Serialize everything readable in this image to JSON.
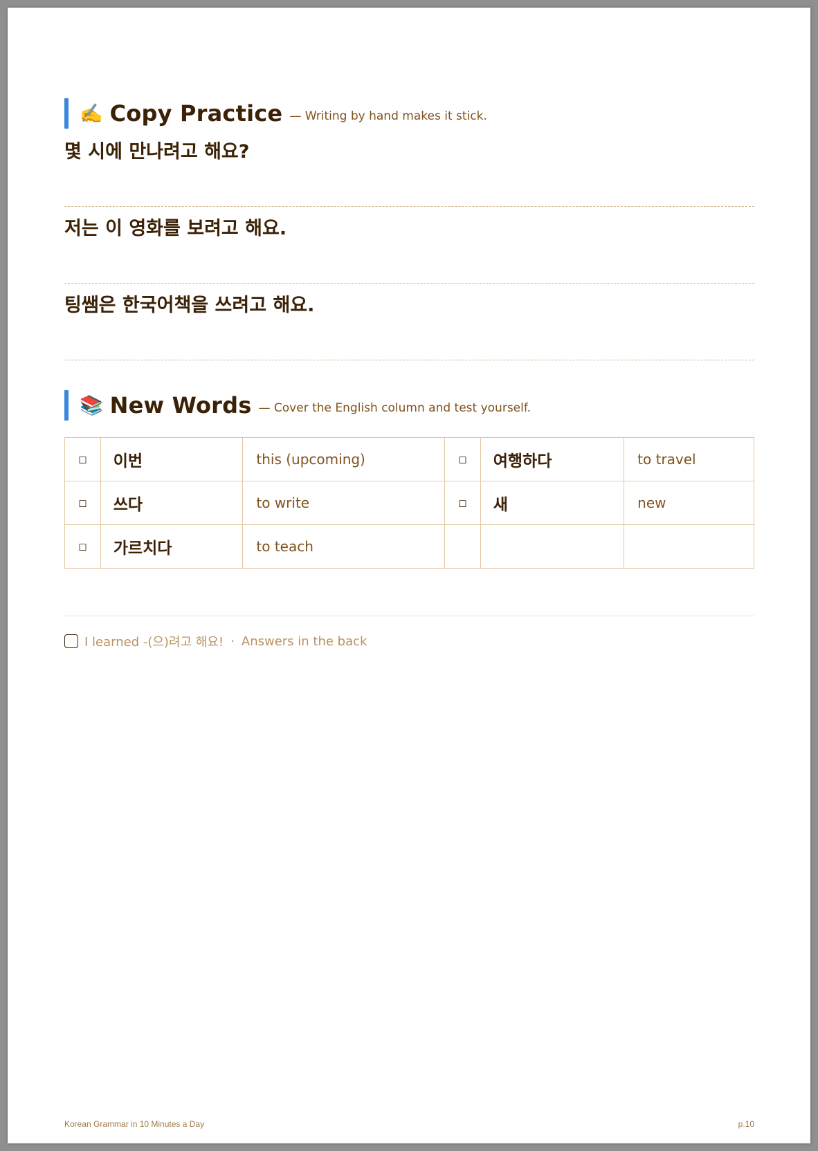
{
  "copy_practice": {
    "emoji": "✍️",
    "title": "Copy Practice",
    "subtitle": "— Writing by hand makes it stick.",
    "sentences": [
      "몇 시에 만나려고 해요?",
      "저는 이 영화를 보려고 해요.",
      "팅쌤은 한국어책을 쓰려고 해요."
    ]
  },
  "new_words": {
    "emoji": "📚",
    "title": "New Words",
    "subtitle": "— Cover the English column and test yourself.",
    "checkbox_glyph": "◻",
    "rows": [
      {
        "left": {
          "ko": "이번",
          "en": "this (upcoming)"
        },
        "right": {
          "ko": "여행하다",
          "en": "to travel"
        }
      },
      {
        "left": {
          "ko": "쓰다",
          "en": "to write"
        },
        "right": {
          "ko": "새",
          "en": "new"
        }
      },
      {
        "left": {
          "ko": "가르치다",
          "en": "to teach"
        },
        "right": null
      }
    ]
  },
  "footer": {
    "learned_text": "I learned -(으)려고 해요!",
    "separator": "·",
    "answers_text": "Answers in the back"
  },
  "page_footer": {
    "book_title": "Korean Grammar in 10 Minutes a Day",
    "page_number": "p.10"
  },
  "colors": {
    "accent": "#3a87db",
    "heading_text": "#3b2207",
    "sub_text": "#80521d",
    "table_border": "#e3c6a0",
    "dashed_line": "#d8b48c",
    "footer_text": "#b8935f"
  }
}
